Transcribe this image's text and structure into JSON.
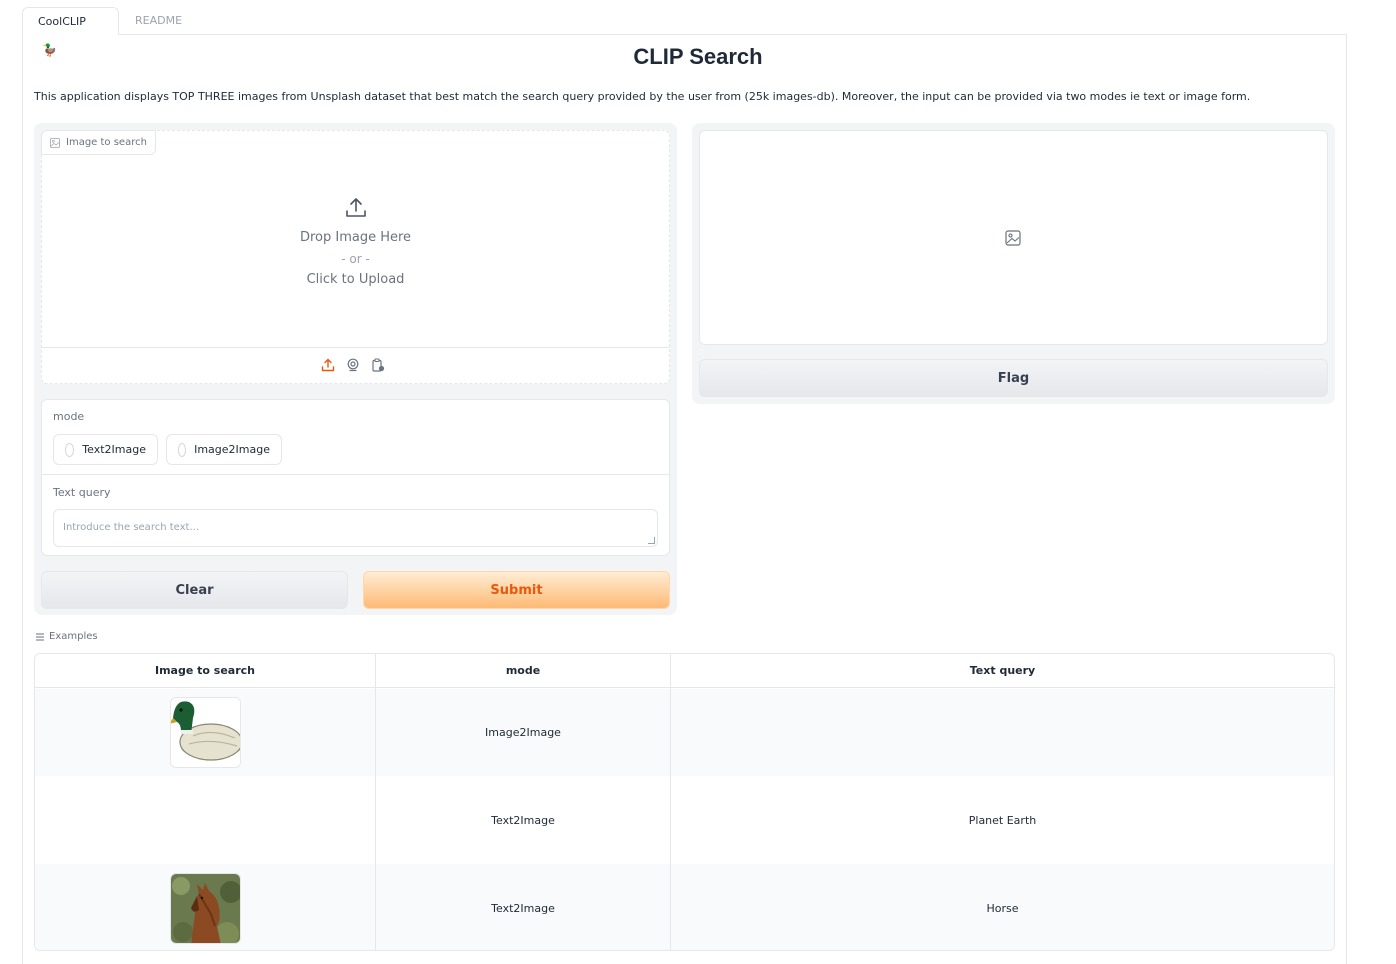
{
  "tabs": [
    {
      "label": "CoolCLIP",
      "emoji": "🦆"
    },
    {
      "label": "README"
    }
  ],
  "header": {
    "title": "CLIP Search",
    "description": "This application displays TOP THREE images from Unsplash dataset that best match the search query provided by the user from (25k images-db). Moreover, the input can be provided via two modes ie text or image form."
  },
  "image_input": {
    "label": "Image to search",
    "drop_text": "Drop Image Here",
    "or_text": "- or -",
    "click_text": "Click to Upload",
    "tools": [
      "upload-icon",
      "webcam-icon",
      "clipboard-icon"
    ]
  },
  "mode": {
    "label": "mode",
    "options": [
      "Text2Image",
      "Image2Image"
    ]
  },
  "text_query": {
    "label": "Text query",
    "placeholder": "Introduce the search text..."
  },
  "buttons": {
    "clear": "Clear",
    "submit": "Submit",
    "flag": "Flag"
  },
  "examples": {
    "label": "Examples",
    "headers": [
      "Image to search",
      "mode",
      "Text query"
    ],
    "rows": [
      {
        "image": "duck-image",
        "mode": "Image2Image",
        "query": ""
      },
      {
        "image": "",
        "mode": "Text2Image",
        "query": "Planet Earth"
      },
      {
        "image": "horse-image",
        "mode": "Text2Image",
        "query": "Horse"
      }
    ]
  },
  "colors": {
    "accent": "#ea580c",
    "submit_bg": "#fdba74",
    "border": "#e5e7eb"
  }
}
